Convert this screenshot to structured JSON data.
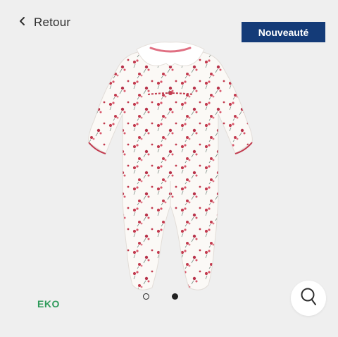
{
  "header": {
    "back_label": "Retour",
    "back_icon": "chevron-left-icon",
    "badge_label": "Nouveauté"
  },
  "product": {
    "image_subject": "baby sleepsuit with floral print",
    "fabric_color": "#fbf9f6",
    "accent_color": "#c23a4e"
  },
  "footer": {
    "brand_logo": "EKO",
    "brand_color": "#2e9a5a",
    "carousel": {
      "count": 2,
      "active_index": 1
    },
    "zoom_icon": "search-icon"
  },
  "colors": {
    "background": "#efefef",
    "badge_bg": "#143b78",
    "text": "#2f2f2f"
  }
}
